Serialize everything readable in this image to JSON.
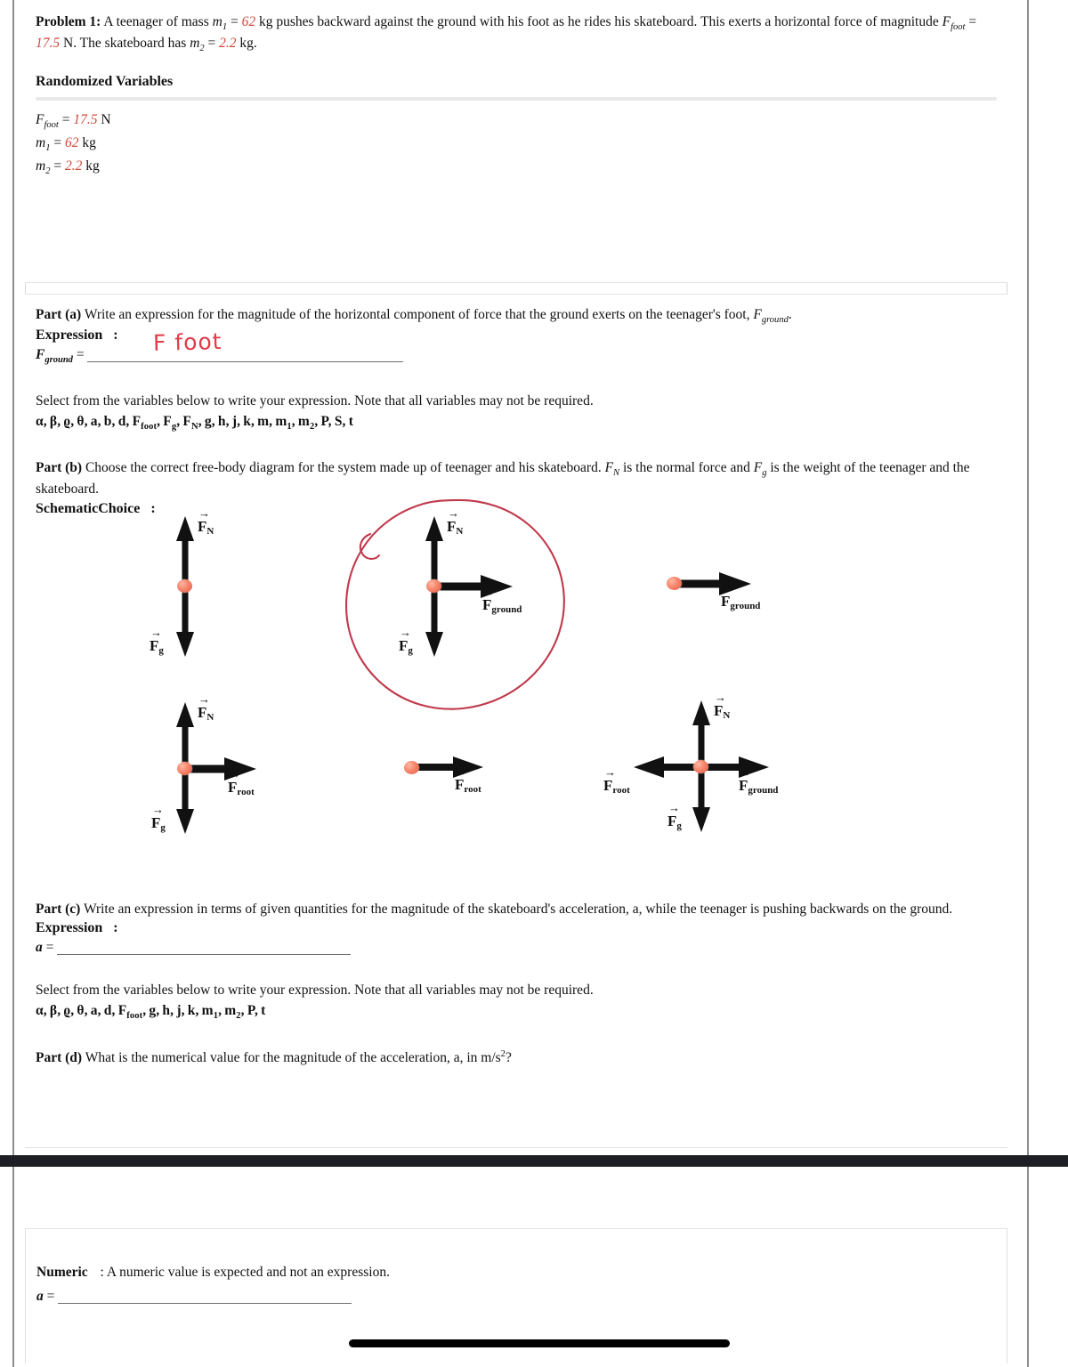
{
  "problem": {
    "label": "Problem 1:",
    "text_a": "A teenager of mass ",
    "m1_sym": "m",
    "m1_sub": "1",
    "eq1": " = ",
    "m1_val": "62",
    "text_b": " kg pushes backward against the ground with his foot as he rides his skateboard. This exerts a horizontal force of magnitude ",
    "F_sym": "F",
    "F_sub": "foot",
    "F_val": "17.5",
    "text_c": " N. The skateboard has ",
    "m2_sym": "m",
    "m2_sub": "2",
    "m2_val": "2.2",
    "text_d": " kg."
  },
  "randomized": {
    "heading": "Randomized Variables",
    "items": [
      {
        "sym": "F",
        "sub": "foot",
        "value": "17.5",
        "unit": "N"
      },
      {
        "sym": "m",
        "sub": "1",
        "value": "62",
        "unit": "kg"
      },
      {
        "sym": "m",
        "sub": "2",
        "value": "2.2",
        "unit": "kg"
      }
    ]
  },
  "part_a": {
    "label": "Part (a)",
    "prompt": "Write an expression for the magnitude of the horizontal component of force that the ground exerts on the teenager's foot, ",
    "prompt_sym": "F",
    "prompt_sub": "ground",
    "prompt_end": ".",
    "expression_label": "Expression",
    "colon": ":",
    "answer_sym": "F",
    "answer_sub": "ground",
    "equals": "=",
    "handwritten_answer": "F foot",
    "select_note": "Select from the variables below to write your expression. Note that all variables may not be required.",
    "variables": "α, β, ϱ, θ, a, b, d, F_foot, F_g, F_N, g, h, j, k, m, m₁, m₂, P, S, t"
  },
  "part_b": {
    "label": "Part (b)",
    "prompt_1": "Choose the correct free-body diagram for the system made up of teenager and his skateboard. ",
    "FN_sym": "F",
    "FN_sub": "N",
    "prompt_2": " is the normal force and ",
    "Fg_sym": "F",
    "Fg_sub": "g",
    "prompt_3": " is the weight of the teenager and the skateboard.",
    "choice_label": "SchematicChoice",
    "colon": ":",
    "selected_index": 1,
    "diagrams": [
      {
        "id": "fbd-1",
        "arrows": [
          "up",
          "down"
        ],
        "labels": [
          "F_N",
          "F_g"
        ],
        "selected": false
      },
      {
        "id": "fbd-2",
        "arrows": [
          "up",
          "down",
          "right"
        ],
        "labels": [
          "F_N",
          "F_g",
          "F_ground"
        ],
        "selected": true
      },
      {
        "id": "fbd-3",
        "arrows": [
          "right"
        ],
        "labels": [
          "F_ground"
        ],
        "selected": false
      },
      {
        "id": "fbd-4",
        "arrows": [
          "up",
          "down",
          "right"
        ],
        "labels": [
          "F_N",
          "F_g",
          "F_root"
        ],
        "selected": false
      },
      {
        "id": "fbd-5",
        "arrows": [
          "right"
        ],
        "labels": [
          "F_root"
        ],
        "selected": false
      },
      {
        "id": "fbd-6",
        "arrows": [
          "up",
          "down",
          "right",
          "left"
        ],
        "labels": [
          "F_N",
          "F_g",
          "F_ground",
          "F_root"
        ],
        "selected": false
      }
    ]
  },
  "part_c": {
    "label": "Part (c)",
    "prompt": "Write an expression in terms of given quantities for the magnitude of the skateboard's acceleration, a, while the teenager is pushing backwards on the ground.",
    "expression_label": "Expression",
    "colon": ":",
    "answer_sym": "a",
    "equals": "=",
    "answer_value": "",
    "select_note": "Select from the variables below to write your expression. Note that all variables may not be required.",
    "variables": "α, β, ϱ, θ, a, d, F_foot, g, h, j, k, m₁, m₂, P, t"
  },
  "part_d": {
    "label": "Part (d)",
    "prompt": "What is the numerical value for the magnitude of the acceleration, a, in m/s",
    "exponent": "2",
    "prompt_end": "?"
  },
  "numeric": {
    "label": "Numeric",
    "colon": ":",
    "note": "A numeric value is expected and not an expression.",
    "answer_sym": "a",
    "equals": "=",
    "answer_value": ""
  },
  "colors": {
    "randomized_value": "#cf4a3a",
    "handwriting": "#e23b4a",
    "selection_circle": "#c0394b",
    "dot": "#f6846a",
    "black_bar": "#1d1f24"
  },
  "labels_text": {
    "F": "F",
    "N": "N",
    "g": "g",
    "ground": "ground",
    "root": "root",
    "foot": "foot"
  }
}
